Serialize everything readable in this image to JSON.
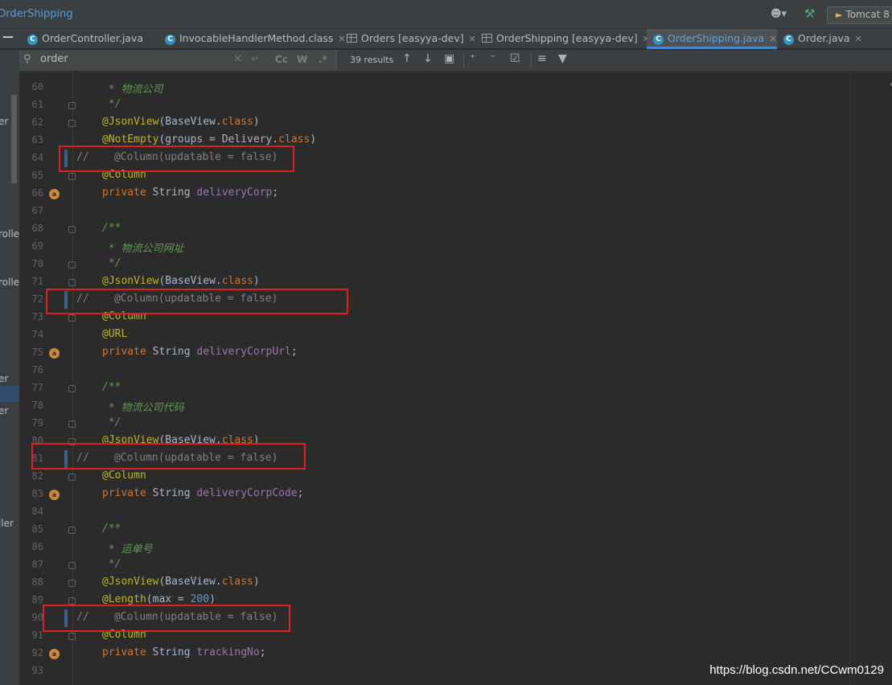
{
  "breadcrumb": "OrderShipping",
  "run_config": "Tomcat 8",
  "tabs": [
    {
      "label": "OrderController.java",
      "icon": "class-icon",
      "active": false
    },
    {
      "label": "InvocableHandlerMethod.class",
      "icon": "class-icon",
      "active": false
    },
    {
      "label": "Orders [easyya-dev]",
      "icon": "table-icon",
      "active": false
    },
    {
      "label": "OrderShipping [easyya-dev]",
      "icon": "table-icon",
      "active": false
    },
    {
      "label": "OrderShipping.java",
      "icon": "class-icon",
      "active": true
    },
    {
      "label": "Order.java",
      "icon": "class-icon",
      "active": false
    }
  ],
  "find": {
    "query": "order",
    "opt_case": "Cc",
    "opt_words": "W",
    "opt_regex": ".*",
    "results": "39 results"
  },
  "left_strip": [
    "er",
    "rolle",
    "rolle",
    "er",
    "er",
    "ller"
  ],
  "lines": [
    {
      "n": "60",
      "html": "<span class='doc'> * 物流公司</span>"
    },
    {
      "n": "61",
      "html": "<span class='doc'> */</span>"
    },
    {
      "n": "62",
      "html": "<span class='ann'>@JsonView</span>(BaseView.<span class='kw'>class</span>)"
    },
    {
      "n": "63",
      "html": "<span class='ann'>@NotEmpty</span>(groups = Delivery.<span class='kw'>class</span>)"
    },
    {
      "n": "64",
      "html": "<span class='cmt'>//    @Column(updatable = false)</span>"
    },
    {
      "n": "65",
      "html": "<span class='ann'>@Column</span>"
    },
    {
      "n": "66",
      "html": "<span class='kw'>private</span> String <span class='fld'>deliveryCorp</span>;"
    },
    {
      "n": "67",
      "html": ""
    },
    {
      "n": "68",
      "html": "<span class='doc'>/**</span>"
    },
    {
      "n": "69",
      "html": "<span class='doc'> * 物流公司网址</span>"
    },
    {
      "n": "70",
      "html": "<span class='doc'> */</span>"
    },
    {
      "n": "71",
      "html": "<span class='ann'>@JsonView</span>(BaseView.<span class='kw'>class</span>)"
    },
    {
      "n": "72",
      "html": "<span class='cmt'>//    @Column(updatable = false)</span>"
    },
    {
      "n": "73",
      "html": "<span class='ann'>@Column</span>"
    },
    {
      "n": "74",
      "html": "<span class='ann'>@URL</span>"
    },
    {
      "n": "75",
      "html": "<span class='kw'>private</span> String <span class='fld'>deliveryCorpUrl</span>;"
    },
    {
      "n": "76",
      "html": ""
    },
    {
      "n": "77",
      "html": "<span class='doc'>/**</span>"
    },
    {
      "n": "78",
      "html": "<span class='doc'> * 物流公司代码</span>"
    },
    {
      "n": "79",
      "html": "<span class='doc'> */</span>"
    },
    {
      "n": "80",
      "html": "<span class='ann'>@JsonView</span>(BaseView.<span class='kw'>class</span>)"
    },
    {
      "n": "81",
      "html": "<span class='cmt'>//    @Column(updatable = false)</span>"
    },
    {
      "n": "82",
      "html": "<span class='ann'>@Column</span>"
    },
    {
      "n": "83",
      "html": "<span class='kw'>private</span> String <span class='fld'>deliveryCorpCode</span>;"
    },
    {
      "n": "84",
      "html": ""
    },
    {
      "n": "85",
      "html": "<span class='doc'>/**</span>"
    },
    {
      "n": "86",
      "html": "<span class='doc'> * 运单号</span>"
    },
    {
      "n": "87",
      "html": "<span class='doc'> */</span>"
    },
    {
      "n": "88",
      "html": "<span class='ann'>@JsonView</span>(BaseView.<span class='kw'>class</span>)"
    },
    {
      "n": "89",
      "html": "<span class='ann'>@Length</span>(max = <span class='num'>200</span>)"
    },
    {
      "n": "90",
      "html": "<span class='cmt'>//    @Column(updatable = false)</span>"
    },
    {
      "n": "91",
      "html": "<span class='ann'>@Column</span>"
    },
    {
      "n": "92",
      "html": "<span class='kw'>private</span> String <span class='fld'>trackingNo</span>;"
    },
    {
      "n": "93",
      "html": ""
    }
  ],
  "watermark": "https://blog.csdn.net/CCwm0129"
}
